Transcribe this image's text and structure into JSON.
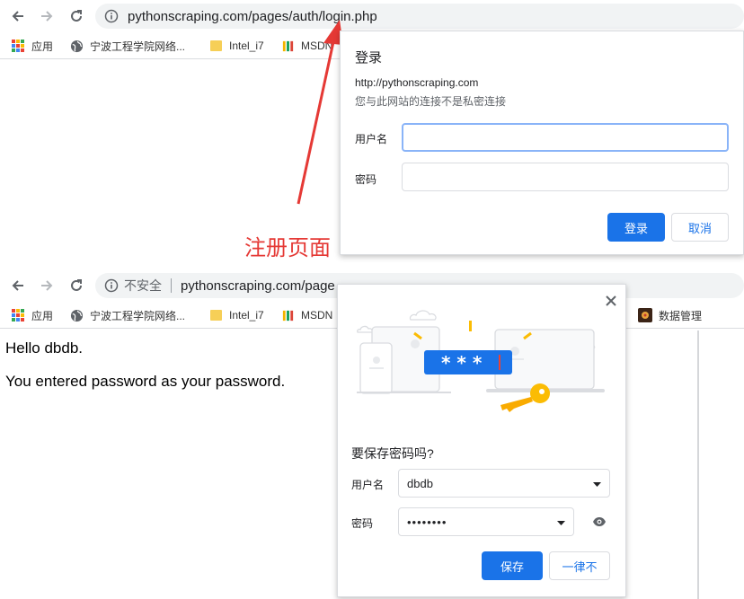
{
  "top": {
    "url": "pythonscraping.com/pages/auth/login.php",
    "bookmarks": [
      "应用",
      "宁波工程学院网络...",
      "Intel_i7",
      "MSDN"
    ],
    "auth_dialog": {
      "title": "登录",
      "site": "http://pythonscraping.com",
      "warning": "您与此网站的连接不是私密连接",
      "username_label": "用户名",
      "password_label": "密码",
      "login_button": "登录",
      "cancel_button": "取消"
    },
    "annotation": "注册页面"
  },
  "bottom": {
    "security_label": "不安全",
    "url": "pythonscraping.com/page",
    "bookmarks": [
      "应用",
      "宁波工程学院网络...",
      "Intel_i7",
      "MSDN",
      "数据管理"
    ],
    "page": {
      "line1": "Hello dbdb.",
      "line2": "You entered password as your password."
    },
    "save_dialog": {
      "question": "要保存密码吗?",
      "username_label": "用户名",
      "username_value": "dbdb",
      "password_label": "密码",
      "password_value": "••••••••",
      "save_button": "保存",
      "never_button": "一律不"
    }
  },
  "colors": {
    "accent": "#1a73e8",
    "annotation": "#e53935",
    "folder": "#f6cf57"
  }
}
